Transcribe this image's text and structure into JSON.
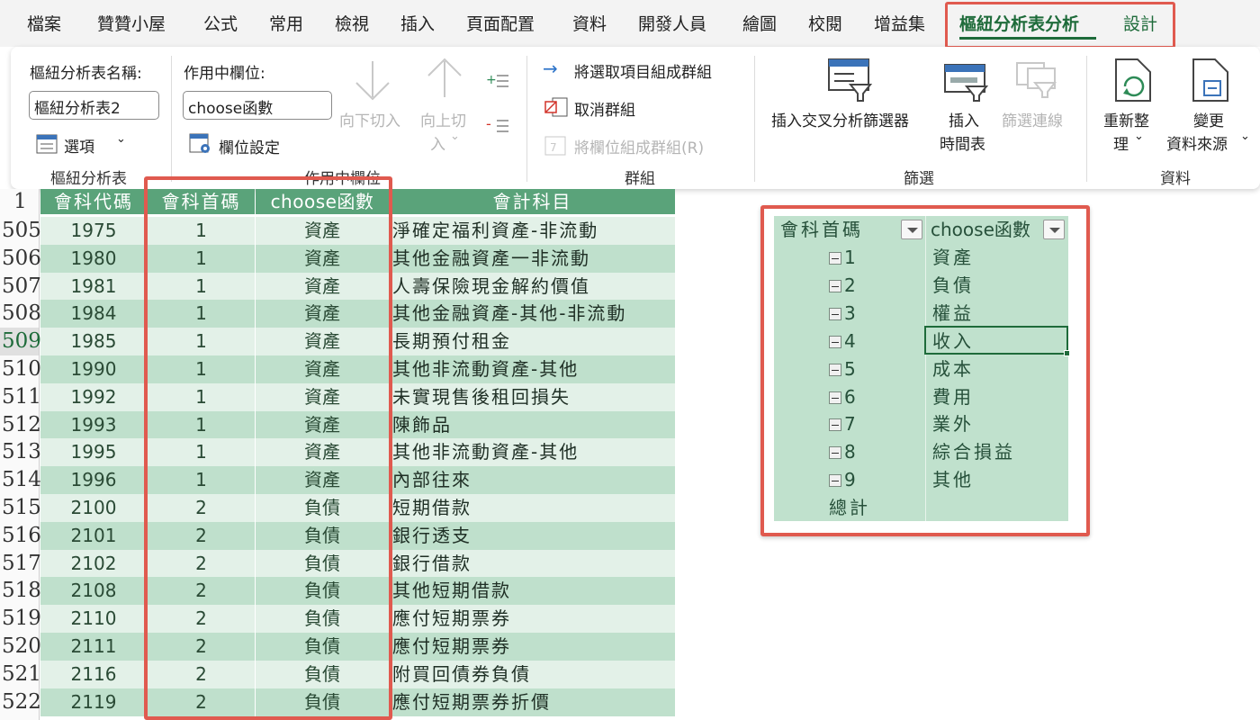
{
  "ribbon_tabs": {
    "file": "檔案",
    "zanzan": "贊贊小屋",
    "formulas": "公式",
    "home": "常用",
    "view": "檢視",
    "insert": "插入",
    "page_layout": "頁面配置",
    "data": "資料",
    "developer": "開發人員",
    "draw": "繪圖",
    "review": "校閱",
    "addins": "增益集",
    "pivot_analyze": "樞紐分析表分析",
    "design": "設計"
  },
  "pivot_group": {
    "name_label": "樞紐分析表名稱:",
    "name_value": "樞紐分析表2",
    "options": "選項",
    "group_label": "樞紐分析表"
  },
  "active_field": {
    "label": "作用中欄位:",
    "value": "choose函數",
    "drill_down": "向下切入",
    "drill_up_1": "向上切",
    "drill_up_2": "入",
    "field_settings": "欄位設定",
    "group_label": "作用中欄位"
  },
  "group_group": {
    "group_selection": "將選取項目組成群組",
    "ungroup": "取消群組",
    "group_field": "將欄位組成群組(R)",
    "group_label": "群組"
  },
  "filter_group": {
    "slicer": "插入交叉分析篩選器",
    "timeline_1": "插入",
    "timeline_2": "時間表",
    "filter_connections": "篩選連線",
    "group_label": "篩選"
  },
  "data_group": {
    "refresh_1": "重新整",
    "refresh_2": "理",
    "change_source_1": "變更",
    "change_source_2": "資料來源",
    "group_label": "資料"
  },
  "sheet": {
    "header_row": "1",
    "headers": [
      "會科代碼",
      "會科首碼",
      "choose函數",
      "會計科目"
    ],
    "rows": [
      [
        "505",
        "1975",
        "1",
        "資產",
        "淨確定福利資產-非流動"
      ],
      [
        "506",
        "1980",
        "1",
        "資產",
        "其他金融資產一非流動"
      ],
      [
        "507",
        "1981",
        "1",
        "資產",
        "人壽保險現金解約價值"
      ],
      [
        "508",
        "1984",
        "1",
        "資產",
        "其他金融資產-其他-非流動"
      ],
      [
        "509",
        "1985",
        "1",
        "資產",
        "長期預付租金"
      ],
      [
        "510",
        "1990",
        "1",
        "資產",
        "其他非流動資產-其他"
      ],
      [
        "511",
        "1992",
        "1",
        "資產",
        "未實現售後租回損失"
      ],
      [
        "512",
        "1993",
        "1",
        "資產",
        "陳飾品"
      ],
      [
        "513",
        "1995",
        "1",
        "資產",
        "其他非流動資產-其他"
      ],
      [
        "514",
        "1996",
        "1",
        "資產",
        "內部往來"
      ],
      [
        "515",
        "2100",
        "2",
        "負債",
        "短期借款"
      ],
      [
        "516",
        "2101",
        "2",
        "負債",
        "銀行透支"
      ],
      [
        "517",
        "2102",
        "2",
        "負債",
        "銀行借款"
      ],
      [
        "518",
        "2108",
        "2",
        "負債",
        "其他短期借款"
      ],
      [
        "519",
        "2110",
        "2",
        "負債",
        "應付短期票券"
      ],
      [
        "520",
        "2111",
        "2",
        "負債",
        "應付短期票券"
      ],
      [
        "521",
        "2116",
        "2",
        "負債",
        "附買回債券負債"
      ],
      [
        "522",
        "2119",
        "2",
        "負債",
        "應付短期票券折價"
      ]
    ]
  },
  "pivot": {
    "col1_header": "會科首碼",
    "col2_header": "choose函數",
    "rows": [
      [
        "1",
        "資產"
      ],
      [
        "2",
        "負債"
      ],
      [
        "3",
        "權益"
      ],
      [
        "4",
        "收入"
      ],
      [
        "5",
        "成本"
      ],
      [
        "6",
        "費用"
      ],
      [
        "7",
        "業外"
      ],
      [
        "8",
        "綜合損益"
      ],
      [
        "9",
        "其他"
      ]
    ],
    "total": "總計"
  },
  "colors": {
    "header_green": "#5aa37a",
    "band_dark": "#bfe0cc",
    "band_light": "#e3f1e8",
    "highlight_red": "#e05a4f",
    "accent_green": "#1e6b3a"
  }
}
